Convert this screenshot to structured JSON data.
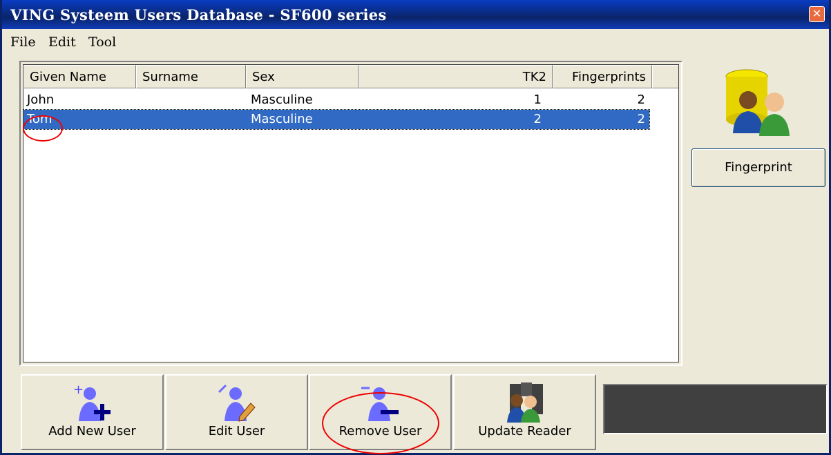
{
  "window": {
    "title": "VING Systeem Users Database - SF600 series",
    "close_glyph": "✕"
  },
  "menu": [
    "File",
    "Edit",
    "Tool"
  ],
  "table": {
    "columns": [
      "Given Name",
      "Surname",
      "Sex",
      "TK2",
      "Fingerprints"
    ],
    "rows": [
      {
        "given_name": "John",
        "surname": "",
        "sex": "Masculine",
        "tk2": "1",
        "fingerprints": "2",
        "selected": false
      },
      {
        "given_name": "Tom",
        "surname": "",
        "sex": "Masculine",
        "tk2": "2",
        "fingerprints": "2",
        "selected": true
      }
    ]
  },
  "side": {
    "fingerprint_button": "Fingerprint",
    "icon": "users-database-icon"
  },
  "actions": {
    "add_user": "Add New User",
    "edit_user": "Edit User",
    "remove_user": "Remove User",
    "update_reader": "Update Reader"
  },
  "colors": {
    "titlebar": "#0a246a",
    "selection": "#316ac5",
    "annotation": "#e00000",
    "status_panel": "#404040"
  }
}
